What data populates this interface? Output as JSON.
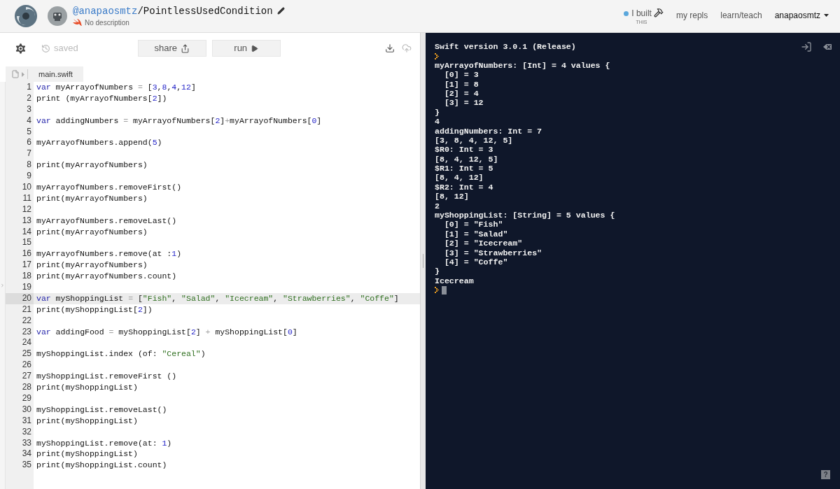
{
  "header": {
    "owner": "@anapaosmtz",
    "repl_name": "/PointlessUsedCondition",
    "description": "No description",
    "nav": [
      {
        "kind": "built",
        "label": "I built",
        "sublabel": "THIS"
      },
      {
        "kind": "link",
        "label": "my repls"
      },
      {
        "kind": "link",
        "label": "learn/teach"
      }
    ],
    "user_menu": "anapaosmtz"
  },
  "toolbar": {
    "status": "saved",
    "buttons": [
      {
        "kind": "share",
        "label": "share"
      },
      {
        "kind": "run",
        "label": "run"
      }
    ]
  },
  "file_tab": "main.swift",
  "editor": {
    "lines": [
      {
        "number": "1",
        "current": false,
        "tokens": [
          {
            "kind": "keyword",
            "text": "var"
          },
          {
            "kind": "plain",
            "text": " myArrayofNumbers "
          },
          {
            "kind": "operator",
            "text": "="
          },
          {
            "kind": "plain",
            "text": " ["
          },
          {
            "kind": "number",
            "text": "3"
          },
          {
            "kind": "plain",
            "text": ","
          },
          {
            "kind": "number",
            "text": "8"
          },
          {
            "kind": "plain",
            "text": ","
          },
          {
            "kind": "number",
            "text": "4"
          },
          {
            "kind": "plain",
            "text": ","
          },
          {
            "kind": "number",
            "text": "12"
          },
          {
            "kind": "plain",
            "text": "]"
          }
        ]
      },
      {
        "number": "2",
        "current": false,
        "tokens": [
          {
            "kind": "plain",
            "text": "print (myArrayofNumbers["
          },
          {
            "kind": "number",
            "text": "2"
          },
          {
            "kind": "plain",
            "text": "])"
          }
        ]
      },
      {
        "number": "3",
        "current": false
      },
      {
        "number": "4",
        "current": false,
        "tokens": [
          {
            "kind": "keyword",
            "text": "var"
          },
          {
            "kind": "plain",
            "text": " addingNumbers "
          },
          {
            "kind": "operator",
            "text": "="
          },
          {
            "kind": "plain",
            "text": " myArrayofNumbers["
          },
          {
            "kind": "number",
            "text": "2"
          },
          {
            "kind": "plain",
            "text": "]"
          },
          {
            "kind": "operator",
            "text": "+"
          },
          {
            "kind": "plain",
            "text": "myArrayofNumbers["
          },
          {
            "kind": "number",
            "text": "0"
          },
          {
            "kind": "plain",
            "text": "]"
          }
        ]
      },
      {
        "number": "5",
        "current": false
      },
      {
        "number": "6",
        "current": false,
        "tokens": [
          {
            "kind": "plain",
            "text": "myArrayofNumbers.append("
          },
          {
            "kind": "number",
            "text": "5"
          },
          {
            "kind": "plain",
            "text": ")"
          }
        ]
      },
      {
        "number": "7",
        "current": false
      },
      {
        "number": "8",
        "current": false,
        "tokens": [
          {
            "kind": "plain",
            "text": "print(myArrayofNumbers)"
          }
        ]
      },
      {
        "number": "9",
        "current": false
      },
      {
        "number": "10",
        "current": false,
        "tokens": [
          {
            "kind": "plain",
            "text": "myArrayofNumbers.removeFirst()"
          }
        ]
      },
      {
        "number": "11",
        "current": false,
        "tokens": [
          {
            "kind": "plain",
            "text": "print(myArrayofNumbers)"
          }
        ]
      },
      {
        "number": "12",
        "current": false
      },
      {
        "number": "13",
        "current": false,
        "tokens": [
          {
            "kind": "plain",
            "text": "myArrayofNumbers.removeLast()"
          }
        ]
      },
      {
        "number": "14",
        "current": false,
        "tokens": [
          {
            "kind": "plain",
            "text": "print(myArrayofNumbers)"
          }
        ]
      },
      {
        "number": "15",
        "current": false
      },
      {
        "number": "16",
        "current": false,
        "tokens": [
          {
            "kind": "plain",
            "text": "myArrayofNumbers.remove(at :"
          },
          {
            "kind": "number",
            "text": "1"
          },
          {
            "kind": "plain",
            "text": ")"
          }
        ]
      },
      {
        "number": "17",
        "current": false,
        "tokens": [
          {
            "kind": "plain",
            "text": "print(myArrayofNumbers)"
          }
        ]
      },
      {
        "number": "18",
        "current": false,
        "tokens": [
          {
            "kind": "plain",
            "text": "print(myArrayofNumbers.count)"
          }
        ]
      },
      {
        "number": "19",
        "current": false
      },
      {
        "number": "20",
        "current": true,
        "tokens": [
          {
            "kind": "keyword",
            "text": "var"
          },
          {
            "kind": "plain",
            "text": " myShoppingList "
          },
          {
            "kind": "operator",
            "text": "="
          },
          {
            "kind": "plain",
            "text": " ["
          },
          {
            "kind": "string",
            "text": "\"Fish\""
          },
          {
            "kind": "plain",
            "text": ", "
          },
          {
            "kind": "string",
            "text": "\"Salad\""
          },
          {
            "kind": "plain",
            "text": ", "
          },
          {
            "kind": "string",
            "text": "\"Icecream\""
          },
          {
            "kind": "plain",
            "text": ", "
          },
          {
            "kind": "string",
            "text": "\"Strawberries\""
          },
          {
            "kind": "plain",
            "text": ", "
          },
          {
            "kind": "string",
            "text": "\"Coffe\""
          },
          {
            "kind": "plain",
            "text": "]"
          }
        ]
      },
      {
        "number": "21",
        "current": false,
        "tokens": [
          {
            "kind": "plain",
            "text": "print(myShoppingList["
          },
          {
            "kind": "number",
            "text": "2"
          },
          {
            "kind": "plain",
            "text": "])"
          }
        ]
      },
      {
        "number": "22",
        "current": false
      },
      {
        "number": "23",
        "current": false,
        "tokens": [
          {
            "kind": "keyword",
            "text": "var"
          },
          {
            "kind": "plain",
            "text": " addingFood "
          },
          {
            "kind": "operator",
            "text": "="
          },
          {
            "kind": "plain",
            "text": " myShoppingList["
          },
          {
            "kind": "number",
            "text": "2"
          },
          {
            "kind": "plain",
            "text": "] "
          },
          {
            "kind": "operator",
            "text": "+"
          },
          {
            "kind": "plain",
            "text": " myShoppingList["
          },
          {
            "kind": "number",
            "text": "0"
          },
          {
            "kind": "plain",
            "text": "]"
          }
        ]
      },
      {
        "number": "24",
        "current": false
      },
      {
        "number": "25",
        "current": false,
        "tokens": [
          {
            "kind": "plain",
            "text": "myShoppingList.index (of: "
          },
          {
            "kind": "string",
            "text": "\"Cereal\""
          },
          {
            "kind": "plain",
            "text": ")"
          }
        ]
      },
      {
        "number": "26",
        "current": false
      },
      {
        "number": "27",
        "current": false,
        "tokens": [
          {
            "kind": "plain",
            "text": "myShoppingList.removeFirst ()"
          }
        ]
      },
      {
        "number": "28",
        "current": false,
        "tokens": [
          {
            "kind": "plain",
            "text": "print(myShoppingList)"
          }
        ]
      },
      {
        "number": "29",
        "current": false
      },
      {
        "number": "30",
        "current": false,
        "tokens": [
          {
            "kind": "plain",
            "text": "myShoppingList.removeLast()"
          }
        ]
      },
      {
        "number": "31",
        "current": false,
        "tokens": [
          {
            "kind": "plain",
            "text": "print(myShoppingList)"
          }
        ]
      },
      {
        "number": "32",
        "current": false
      },
      {
        "number": "33",
        "current": false,
        "tokens": [
          {
            "kind": "plain",
            "text": "myShoppingList.remove(at: "
          },
          {
            "kind": "number",
            "text": "1"
          },
          {
            "kind": "plain",
            "text": ")"
          }
        ]
      },
      {
        "number": "34",
        "current": false,
        "tokens": [
          {
            "kind": "plain",
            "text": "print(myShoppingList)"
          }
        ]
      },
      {
        "number": "35",
        "current": false,
        "tokens": [
          {
            "kind": "plain",
            "text": "print(myShoppingList.count)"
          }
        ]
      }
    ]
  },
  "console": {
    "help": "?",
    "lines": [
      {
        "kind": "text",
        "text": "Swift version 3.0.1 (Release)"
      },
      {
        "kind": "prompt",
        "cursor": false
      },
      {
        "kind": "text",
        "text": "myArrayofNumbers: [Int] = 4 values {"
      },
      {
        "kind": "text",
        "text": "  [0] = 3"
      },
      {
        "kind": "text",
        "text": "  [1] = 8"
      },
      {
        "kind": "text",
        "text": "  [2] = 4"
      },
      {
        "kind": "text",
        "text": "  [3] = 12"
      },
      {
        "kind": "text",
        "text": "}"
      },
      {
        "kind": "text",
        "text": "4"
      },
      {
        "kind": "text",
        "text": "addingNumbers: Int = 7"
      },
      {
        "kind": "text",
        "text": "[3, 8, 4, 12, 5]"
      },
      {
        "kind": "text",
        "text": "$R0: Int = 3"
      },
      {
        "kind": "text",
        "text": "[8, 4, 12, 5]"
      },
      {
        "kind": "text",
        "text": "$R1: Int = 5"
      },
      {
        "kind": "text",
        "text": "[8, 4, 12]"
      },
      {
        "kind": "text",
        "text": "$R2: Int = 4"
      },
      {
        "kind": "text",
        "text": "[8, 12]"
      },
      {
        "kind": "text",
        "text": "2"
      },
      {
        "kind": "text",
        "text": "myShoppingList: [String] = 5 values {"
      },
      {
        "kind": "text",
        "text": "  [0] = \"Fish\""
      },
      {
        "kind": "text",
        "text": "  [1] = \"Salad\""
      },
      {
        "kind": "text",
        "text": "  [2] = \"Icecream\""
      },
      {
        "kind": "text",
        "text": "  [3] = \"Strawberries\""
      },
      {
        "kind": "text",
        "text": "  [4] = \"Coffe\""
      },
      {
        "kind": "text",
        "text": "}"
      },
      {
        "kind": "text",
        "text": "Icecream"
      },
      {
        "kind": "prompt",
        "cursor": true
      }
    ]
  }
}
